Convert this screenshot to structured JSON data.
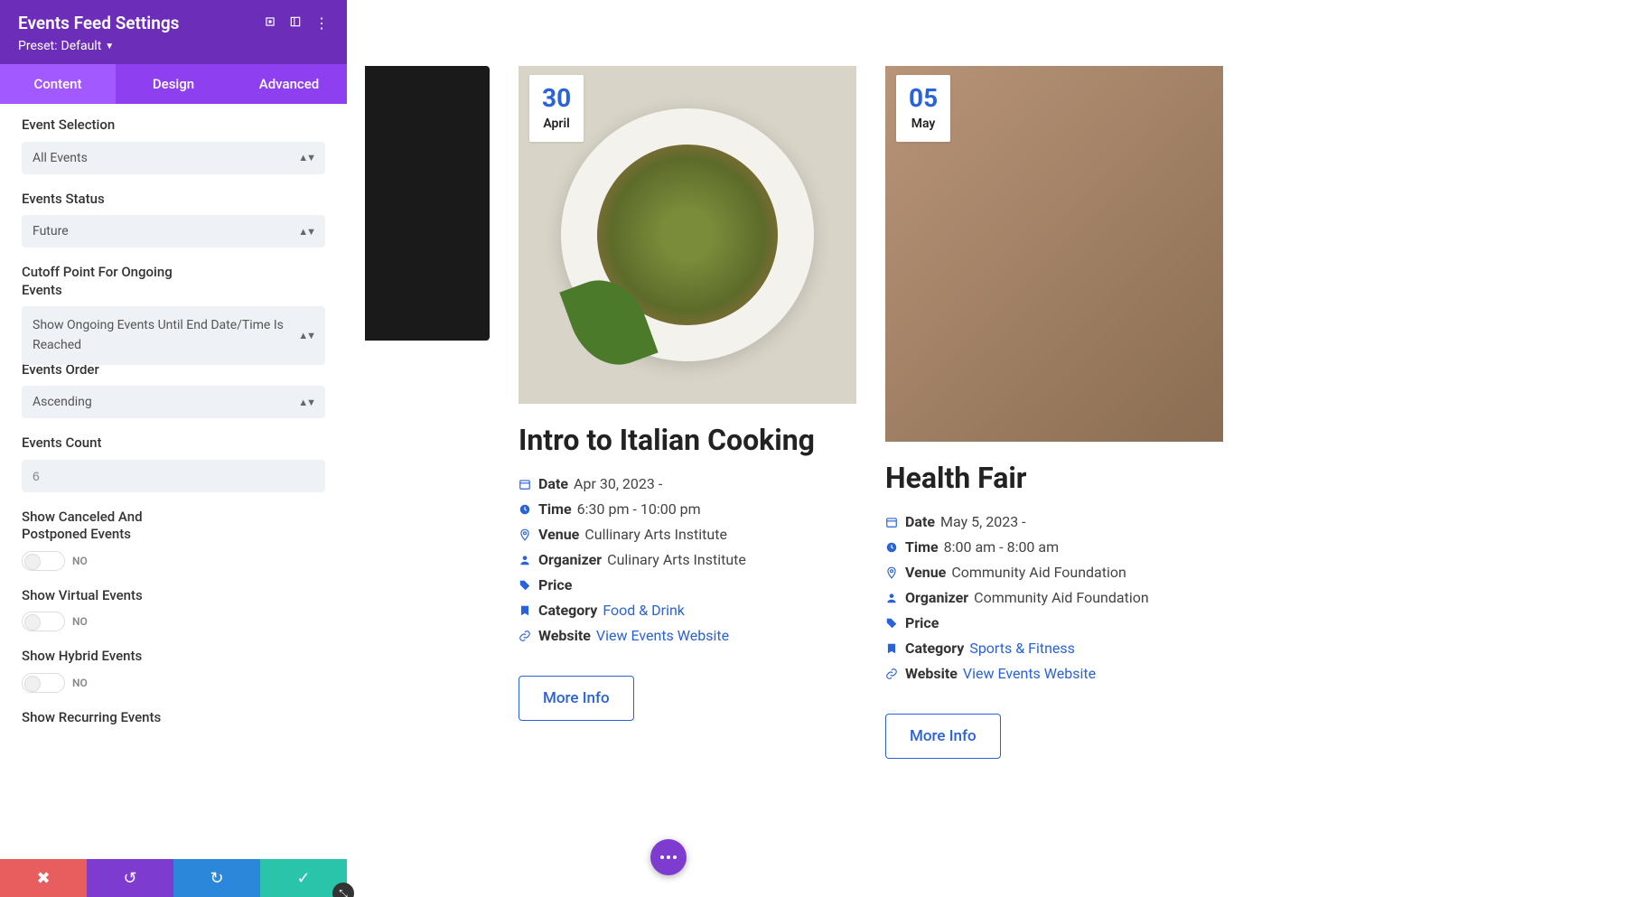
{
  "sidebar": {
    "title": "Events Feed Settings",
    "preset_label": "Preset:",
    "preset_value": "Default",
    "tabs": [
      "Content",
      "Design",
      "Advanced"
    ],
    "fields": {
      "event_selection": {
        "label": "Event Selection",
        "value": "All Events"
      },
      "events_status": {
        "label": "Events Status",
        "value": "Future"
      },
      "cutoff": {
        "label": "Cutoff Point For Ongoing Events",
        "value": "Show Ongoing Events Until End Date/Time Is Reached"
      },
      "events_order": {
        "label": "Events Order",
        "value": "Ascending"
      },
      "events_count": {
        "label": "Events Count",
        "value": "6"
      },
      "show_canceled": {
        "label": "Show Canceled And Postponed Events",
        "value": "NO"
      },
      "show_virtual": {
        "label": "Show Virtual Events",
        "value": "NO"
      },
      "show_hybrid": {
        "label": "Show Hybrid Events",
        "value": "NO"
      },
      "show_recurring": {
        "label": "Show Recurring Events"
      }
    }
  },
  "cards": [
    {
      "date_day": "30",
      "date_month": "April",
      "title": "Intro to Italian Cooking",
      "meta": {
        "date": {
          "label": "Date",
          "value": "Apr 30, 2023 -"
        },
        "time": {
          "label": "Time",
          "value": "6:30 pm - 10:00 pm"
        },
        "venue": {
          "label": "Venue",
          "value": "Cullinary Arts Institute"
        },
        "organizer": {
          "label": "Organizer",
          "value": "Culinary Arts Institute"
        },
        "price": {
          "label": "Price",
          "value": ""
        },
        "category": {
          "label": "Category",
          "link": "Food & Drink"
        },
        "website": {
          "label": "Website",
          "link": "View Events Website"
        }
      },
      "more_info": "More Info"
    },
    {
      "date_day": "05",
      "date_month": "May",
      "title": "Health Fair",
      "meta": {
        "date": {
          "label": "Date",
          "value": "May 5, 2023 -"
        },
        "time": {
          "label": "Time",
          "value": "8:00 am - 8:00 am"
        },
        "venue": {
          "label": "Venue",
          "value": "Community Aid Foundation"
        },
        "organizer": {
          "label": "Organizer",
          "value": "Community Aid Foundation"
        },
        "price": {
          "label": "Price",
          "value": ""
        },
        "category": {
          "label": "Category",
          "link": "Sports & Fitness"
        },
        "website": {
          "label": "Website",
          "link": "View Events Website"
        }
      },
      "more_info": "More Info"
    }
  ]
}
